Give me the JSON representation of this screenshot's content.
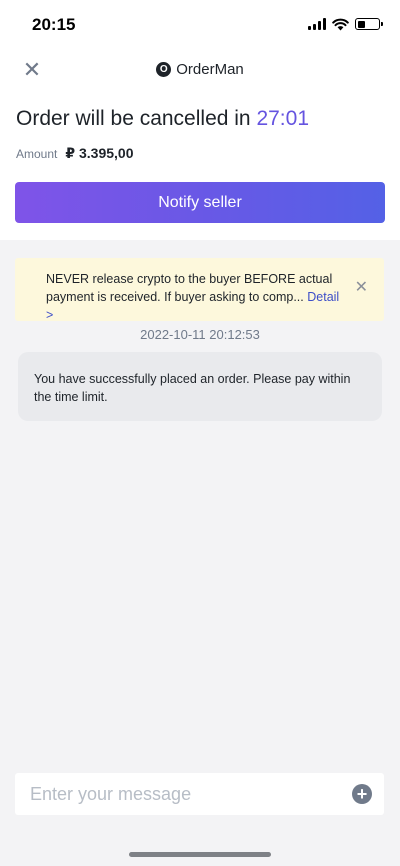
{
  "status_bar": {
    "time": "20:15",
    "battery_level": 0.35
  },
  "header": {
    "close_icon": "close-icon",
    "logo_letter": "O",
    "brand_name": "OrderMan"
  },
  "order": {
    "headline_prefix": "Order will be cancelled in",
    "countdown": "27:01",
    "amount_label": "Amount",
    "amount_value": "₽ 3.395,00",
    "notify_label": "Notify seller"
  },
  "warning": {
    "text": "NEVER release crypto to the buyer BEFORE actual payment is received. If buyer asking to comp...",
    "detail_label": "Detail >"
  },
  "chat": {
    "timestamp": "2022-10-11 20:12:53",
    "message": "You have successfully placed an order. Please pay within the time limit."
  },
  "composer": {
    "placeholder": "Enter your message",
    "add_icon": "plus-circle-icon"
  },
  "colors": {
    "accent": "#6554e0",
    "button_gradient_start": "#7f54e8",
    "button_gradient_end": "#5461e6",
    "warning_bg": "#fdf8dc"
  }
}
